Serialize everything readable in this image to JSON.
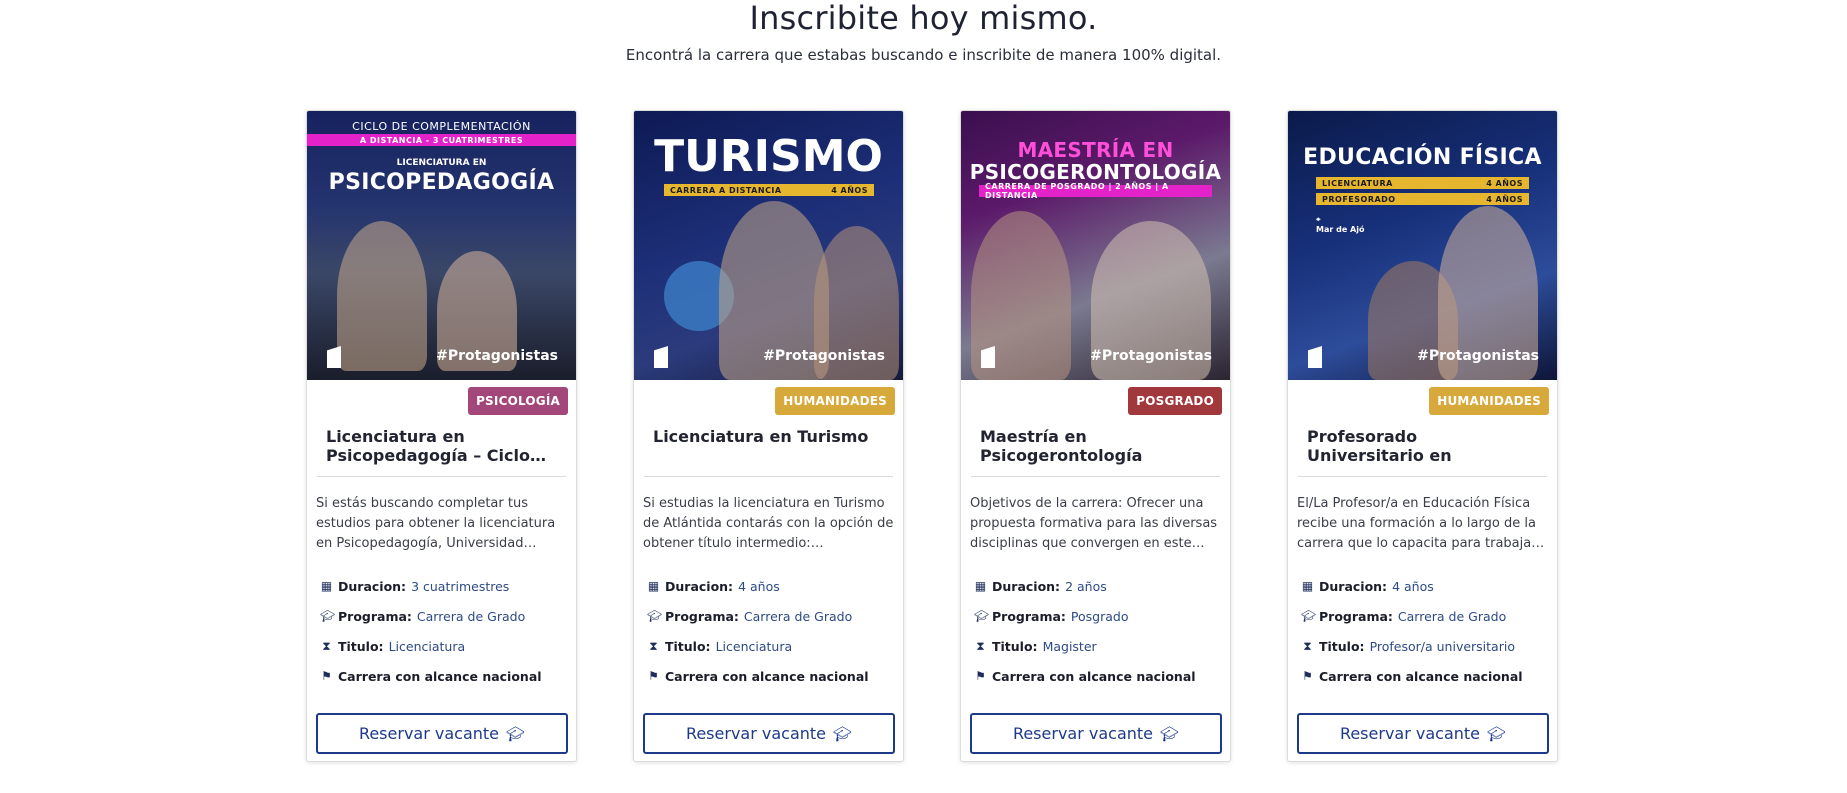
{
  "header": {
    "title": "Inscribite hoy mismo.",
    "subtitle": "Encontrá la carrera que estabas buscando e inscribite de manera 100% digital."
  },
  "common": {
    "duration_label": "Duracion:",
    "program_label": "Programa:",
    "title_label": "Titulo:",
    "national_label": "Carrera con alcance nacional",
    "button_label": "Reservar vacante",
    "hashtag": "#Protagonistas"
  },
  "colors": {
    "accent": "#1d3a8a",
    "badge_psicologia": "#a3467a",
    "badge_humanidades": "#d6a93a",
    "badge_posgrado": "#a0383c"
  },
  "cards": [
    {
      "image": {
        "line1": "CICLO DE COMPLEMENTACIÓN",
        "stripe": "A DISTANCIA - 3 CUATRIMESTRES",
        "line2": "LICENCIATURA EN",
        "title": "PSICOPEDAGOGÍA"
      },
      "badge": "PSICOLOGÍA",
      "title": "Licenciatura en Psicopedagogía – Ciclo…",
      "description": "Si estás buscando completar tus estudios para obtener la licenciatura en Psicopedagogía, Universidad…",
      "duration": "3 cuatrimestres",
      "program": "Carrera de Grado",
      "degree": "Licenciatura"
    },
    {
      "image": {
        "title": "TURISMO",
        "stripe_left": "CARRERA A DISTANCIA",
        "stripe_right": "4 AÑOS"
      },
      "badge": "HUMANIDADES",
      "title": "Licenciatura en Turismo",
      "description": "Si estudias la licenciatura en Turismo de Atlántida contarás con la opción de obtener título intermedio:…",
      "duration": "4 años",
      "program": "Carrera de Grado",
      "degree": "Licenciatura"
    },
    {
      "image": {
        "line1": "MAESTRÍA EN",
        "line2": "PSICOGERONTOLOGÍA",
        "stripe": "CARRERA DE POSGRADO | 2 AÑOS | A DISTANCIA"
      },
      "badge": "POSGRADO",
      "title": "Maestría en Psicogerontología",
      "description": "Objetivos de la carrera: Ofrecer una propuesta formativa para las diversas disciplinas que convergen en este…",
      "duration": "2 años",
      "program": "Posgrado",
      "degree": "Magister"
    },
    {
      "image": {
        "title": "EDUCACIÓN FÍSICA",
        "stripe1_left": "LICENCIATURA",
        "stripe1_right": "4 AÑOS",
        "stripe2_left": "PROFESORADO",
        "stripe2_right": "4 AÑOS",
        "location": "Mar de Ajó"
      },
      "badge": "HUMANIDADES",
      "title": "Profesorado Universitario en Educación Física",
      "description": "El/La Profesor/a en Educación Física recibe una formación a lo largo de la carrera que lo capacita para trabaja…",
      "duration": "4 años",
      "program": "Carrera de Grado",
      "degree": "Profesor/a universitario"
    }
  ]
}
